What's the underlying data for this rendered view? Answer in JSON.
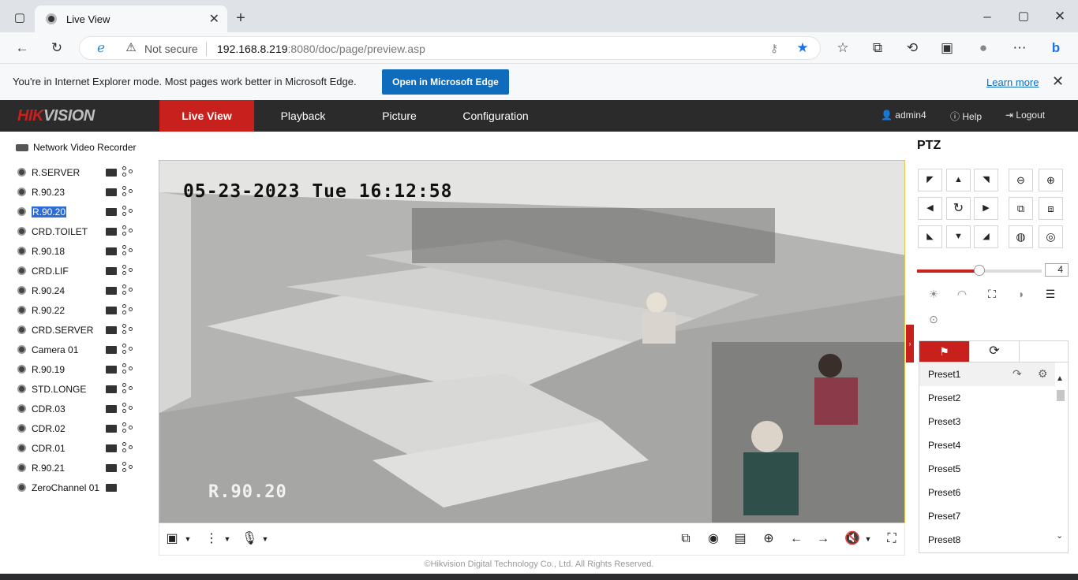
{
  "browser": {
    "tab_title": "Live View",
    "not_secure": "Not secure",
    "url_host": "192.168.8.219",
    "url_rest": ":8080/doc/page/preview.asp",
    "ie_message": "You're in Internet Explorer mode. Most pages work better in Microsoft Edge.",
    "ie_button": "Open in Microsoft Edge",
    "learn_more": "Learn more"
  },
  "header": {
    "logo_red": "HIK",
    "logo_gray": "VISION",
    "nav": [
      "Live View",
      "Playback",
      "Picture",
      "Configuration"
    ],
    "user": "admin4",
    "help": "Help",
    "logout": "Logout"
  },
  "tree": {
    "root": "Network Video Recorder",
    "cameras": [
      "R.SERVER",
      "R.90.23",
      "R.90.20",
      "CRD.TOILET",
      "R.90.18",
      "CRD.LIF",
      "R.90.24",
      "R.90.22",
      "CRD.SERVER",
      "Camera 01",
      "R.90.19",
      "STD.LONGE",
      "CDR.03",
      "CDR.02",
      "CDR.01",
      "R.90.21",
      "ZeroChannel 01"
    ],
    "selected": "R.90.20"
  },
  "video": {
    "osd_datetime": "05-23-2023 Tue 16:12:58",
    "osd_name": "R.90.20"
  },
  "footer": "©Hikvision Digital Technology Co., Ltd. All Rights Reserved.",
  "ptz": {
    "title": "PTZ",
    "speed": "4",
    "speed_level": 0.5,
    "presets": [
      "Preset1",
      "Preset2",
      "Preset3",
      "Preset4",
      "Preset5",
      "Preset6",
      "Preset7",
      "Preset8"
    ]
  },
  "colors": {
    "brand_red": "#c8201c",
    "header_bg": "#2b2b2b",
    "edge_blue": "#0f6cbd"
  }
}
